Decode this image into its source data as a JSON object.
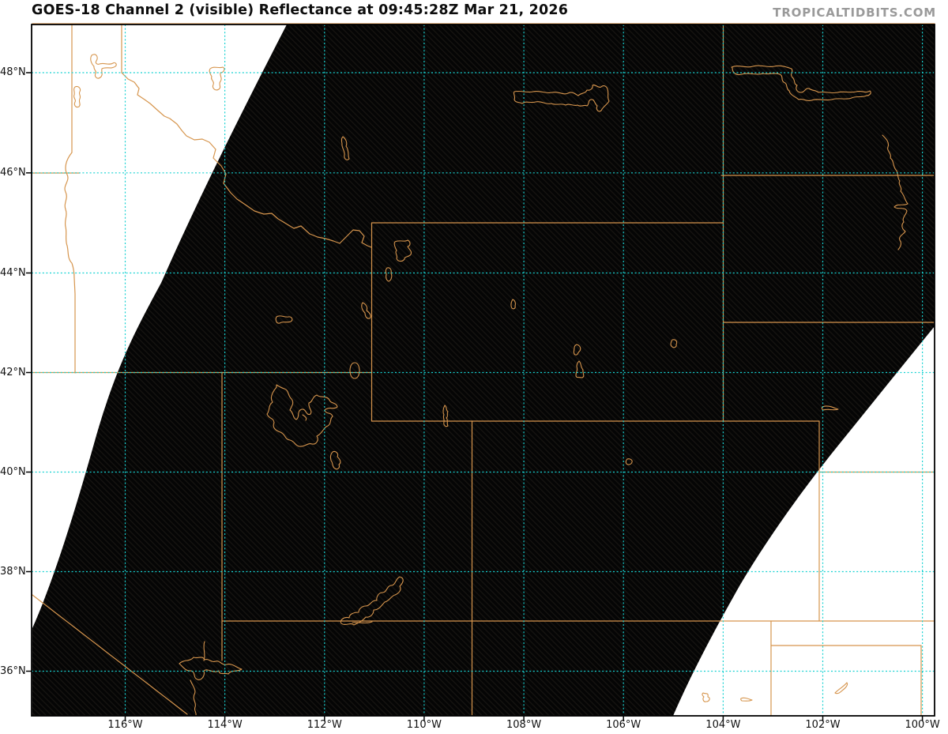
{
  "header": {
    "title": "GOES-18 Channel 2 (visible) Reflectance at 09:45:28Z Mar 21, 2026",
    "watermark": "TROPICALTIDBITS.COM"
  },
  "map": {
    "colors": {
      "page_background": "#ffffff",
      "scan_fill": "#050505",
      "scan_hatch": "#181512",
      "boundary_line": "#d6954d",
      "gridline": "#16d2d2",
      "frame": "#000000",
      "label_text": "#111111",
      "watermark_text": "#9a9a9a"
    },
    "axes": {
      "y": {
        "labels": [
          "48°N",
          "46°N",
          "44°N",
          "42°N",
          "40°N",
          "38°N",
          "36°N"
        ]
      },
      "x": {
        "labels": [
          "116°W",
          "114°W",
          "112°W",
          "110°W",
          "108°W",
          "106°W",
          "104°W",
          "102°W",
          "100°W"
        ]
      }
    }
  }
}
